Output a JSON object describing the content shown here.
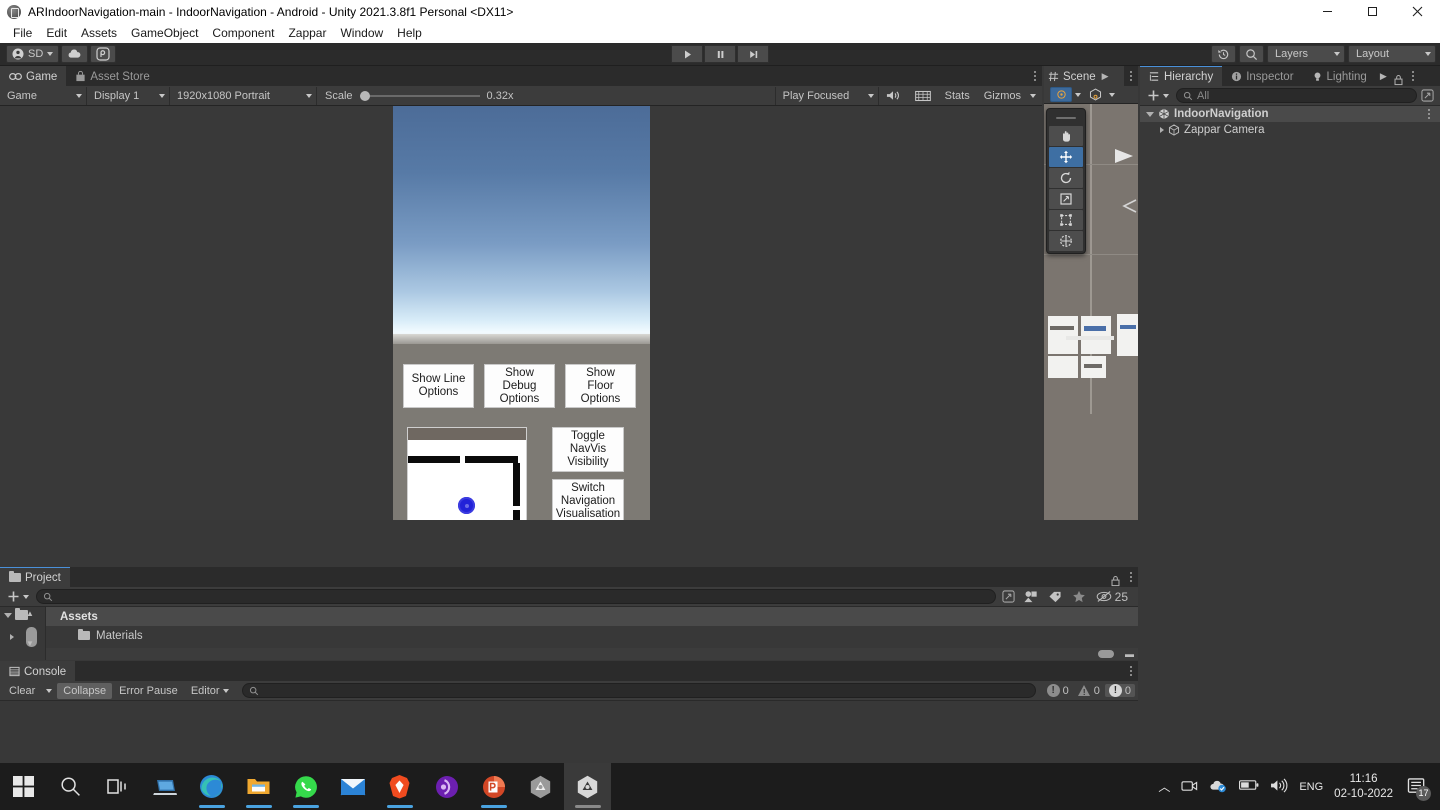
{
  "window": {
    "title": "ARIndoorNavigation-main - IndoorNavigation - Android - Unity 2021.3.8f1 Personal <DX11>",
    "minimize_label": "Minimize",
    "maximize_label": "Maximize",
    "close_label": "Close"
  },
  "menubar": {
    "items": [
      {
        "label": "File"
      },
      {
        "label": "Edit"
      },
      {
        "label": "Assets"
      },
      {
        "label": "GameObject"
      },
      {
        "label": "Component"
      },
      {
        "label": "Zappar"
      },
      {
        "label": "Window"
      },
      {
        "label": "Help"
      }
    ]
  },
  "toolbar": {
    "account_label": "SD",
    "account_icon": "person-icon",
    "cloud_icon": "cloud-icon",
    "services_icon": "services-icon",
    "play_icon": "play-icon",
    "pause_icon": "pause-icon",
    "step_icon": "step-icon",
    "undo_history_icon": "undo-history-icon",
    "search_icon": "search-icon",
    "layers_label": "Layers",
    "layout_label": "Layout"
  },
  "game_panel": {
    "tabs": [
      {
        "label": "Game",
        "icon": "game-icon",
        "active": true
      },
      {
        "label": "Asset Store",
        "icon": "store-icon",
        "active": false
      }
    ],
    "display_mode": "Game",
    "display": "Display 1",
    "resolution": "1920x1080 Portrait",
    "scale_label": "Scale",
    "scale_value": "0.32x",
    "play_mode": "Play Focused",
    "mute_icon": "mute-audio-icon",
    "aspect_icon": "aspect-icon",
    "stats_label": "Stats",
    "gizmos_label": "Gizmos",
    "kebab_icon": "more-options-icon",
    "overlay_buttons_top": [
      {
        "label": "Show Line\nOptions",
        "line1": "Show Line",
        "line2": "Options"
      },
      {
        "label": "Show Debug\nOptions",
        "line1": "Show Debug",
        "line2": "Options"
      },
      {
        "label": "Show Floor\nOptions",
        "line1": "Show Floor",
        "line2": "Options"
      }
    ],
    "overlay_buttons_right": [
      {
        "line1": "Toggle",
        "line2": "NavVis",
        "line3": "Visibility"
      },
      {
        "line1": "Switch",
        "line2": "Navigation",
        "line3": "Visualisation"
      }
    ],
    "dropdown_value": "",
    "minimap_name": "minimap",
    "player_marker_color": "#2222d8",
    "sky_top_color": "#4c6c98",
    "sky_horizon_color": "#f2fbff",
    "ground_color": "#7d7a74"
  },
  "scene_panel": {
    "tab_label": "Scene",
    "expand_icon": "expand-arrow-icon",
    "kebab_icon": "more-options-icon",
    "tools": [
      {
        "name": "hand-tool",
        "glyph": "✋",
        "selected": false
      },
      {
        "name": "move-tool",
        "glyph": "✥",
        "selected": true
      },
      {
        "name": "rotate-tool",
        "glyph": "⟳",
        "selected": false
      },
      {
        "name": "scale-tool",
        "glyph": "⤢",
        "selected": false
      },
      {
        "name": "rect-tool",
        "glyph": "▣",
        "selected": false
      },
      {
        "name": "transform-tool",
        "glyph": "✻",
        "selected": false
      }
    ],
    "pivot_icon": "pivot-icon",
    "handle_icon": "handle-space-icon",
    "viewport_background": "#7b756f"
  },
  "hierarchy_panel": {
    "tabs": [
      {
        "label": "Hierarchy",
        "icon": "hierarchy-icon",
        "active": true
      },
      {
        "label": "Inspector",
        "icon": "info-icon",
        "active": false
      },
      {
        "label": "Lighting",
        "icon": "lightbulb-icon",
        "active": false
      }
    ],
    "lock_icon": "lock-icon",
    "kebab_icon": "more-options-icon",
    "add_label": "+",
    "search_placeholder": "All",
    "search_value": "",
    "items": [
      {
        "label": "IndoorNavigation",
        "icon": "scene-icon",
        "depth": 0,
        "expanded": true,
        "selected": true
      },
      {
        "label": "Zappar Camera",
        "icon": "prefab-icon",
        "depth": 1,
        "expanded": false,
        "selected": false
      }
    ]
  },
  "project_panel": {
    "tab_label": "Project",
    "tab_icon": "folder-icon",
    "lock_icon": "lock-icon",
    "kebab_icon": "more-options-icon",
    "add_label": "+",
    "search_placeholder": "",
    "search_value": "",
    "filter_icons": [
      "save-search-icon",
      "type-filter-icon",
      "label-filter-icon",
      "favorite-icon"
    ],
    "hidden_count": "25",
    "hidden_count_icon": "hidden-packages-icon",
    "rows": [
      {
        "label": "Assets",
        "header": true
      },
      {
        "label": "Materials",
        "header": false
      }
    ]
  },
  "console_panel": {
    "tab_label": "Console",
    "tab_icon": "console-icon",
    "kebab_icon": "more-options-icon",
    "clear_label": "Clear",
    "collapse_label": "Collapse",
    "error_pause_label": "Error Pause",
    "editor_label": "Editor",
    "search_placeholder": "",
    "search_value": "",
    "counters": [
      {
        "name": "log-count",
        "value": "0",
        "type": "log"
      },
      {
        "name": "warning-count",
        "value": "0",
        "type": "warning"
      },
      {
        "name": "error-count",
        "value": "0",
        "type": "error"
      }
    ]
  },
  "status_bar": {
    "icons": [
      {
        "name": "mute-notifications-icon"
      },
      {
        "name": "layers-off-icon"
      },
      {
        "name": "visibility-off-icon"
      },
      {
        "name": "check-circle-icon"
      }
    ]
  },
  "taskbar": {
    "items": [
      {
        "name": "start-button",
        "label": "Start"
      },
      {
        "name": "search-button",
        "label": "Search"
      },
      {
        "name": "task-view-button",
        "label": "Task View"
      },
      {
        "name": "laptop-app",
        "label": "Remote Desktop",
        "running": false
      },
      {
        "name": "edge-browser",
        "label": "Microsoft Edge",
        "running": true
      },
      {
        "name": "file-explorer",
        "label": "File Explorer",
        "running": true
      },
      {
        "name": "whatsapp",
        "label": "WhatsApp",
        "running": true
      },
      {
        "name": "mail-app",
        "label": "Mail",
        "running": false
      },
      {
        "name": "brave-browser",
        "label": "Brave",
        "running": true
      },
      {
        "name": "media-player",
        "label": "Media Player",
        "running": false
      },
      {
        "name": "powerpoint",
        "label": "PowerPoint",
        "running": true
      },
      {
        "name": "unity-hub",
        "label": "Unity Hub",
        "running": false
      },
      {
        "name": "unity-editor",
        "label": "Unity Editor",
        "running": true,
        "active": true
      }
    ],
    "tray": {
      "chevron_icon": "show-hidden-icons",
      "camera_icon": "camera-icon",
      "cloud_sync_icon": "cloud-sync-icon",
      "battery_icon": "battery-icon",
      "volume_icon": "volume-icon",
      "language": "ENG",
      "time": "11:16",
      "date": "02-10-2022",
      "notification_icon": "notifications-icon",
      "notification_count": "17"
    }
  }
}
